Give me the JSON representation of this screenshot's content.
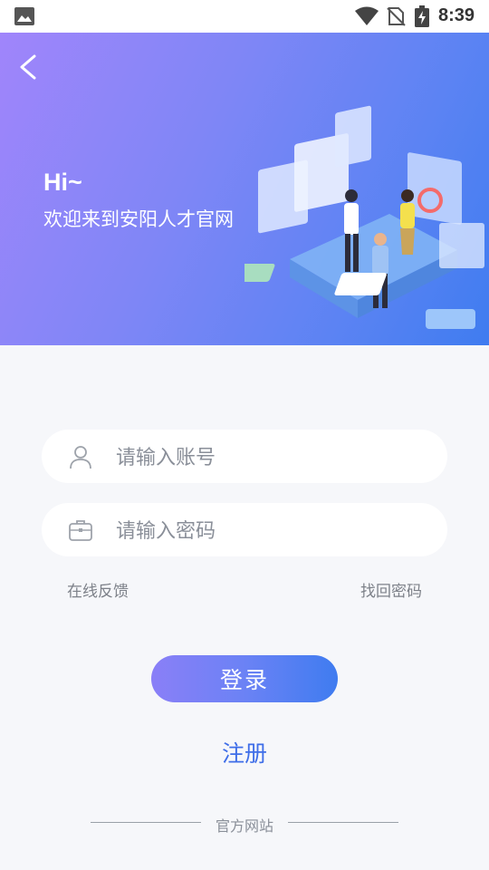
{
  "status_bar": {
    "time": "8:39",
    "icons": [
      "gallery-icon",
      "wifi-icon",
      "no-sim-icon",
      "battery-charging-icon"
    ]
  },
  "header": {
    "back_icon": "chevron-left-icon",
    "greeting": "Hi~",
    "welcome": "欢迎来到安阳人才官网",
    "gradient_colors": [
      "#a085fb",
      "#3f7cf0"
    ]
  },
  "form": {
    "account": {
      "placeholder": "请输入账号",
      "value": "",
      "icon": "user-icon"
    },
    "password": {
      "placeholder": "请输入密码",
      "value": "",
      "icon": "briefcase-icon"
    },
    "feedback_link": "在线反馈",
    "forgot_link": "找回密码"
  },
  "actions": {
    "login_label": "登录",
    "register_label": "注册",
    "accent_color": "#3f6ee8"
  },
  "footer": {
    "label": "官方网站"
  }
}
